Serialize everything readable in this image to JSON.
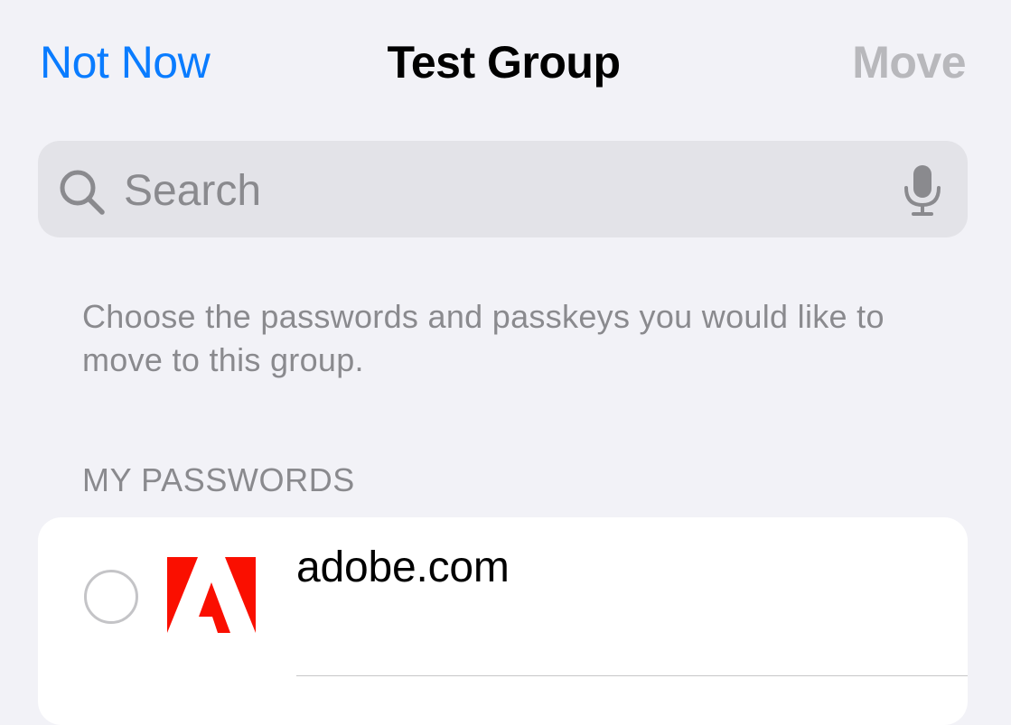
{
  "nav": {
    "left_label": "Not Now",
    "title": "Test Group",
    "right_label": "Move"
  },
  "search": {
    "placeholder": "Search",
    "value": "",
    "left_icon": "magnifying-glass-icon",
    "right_icon": "microphone-icon"
  },
  "description": "Choose the passwords and passkeys you would like to move to this group.",
  "section": {
    "header": "MY PASSWORDS",
    "items": [
      {
        "title": "adobe.com",
        "icon": "adobe-logo",
        "selected": false
      }
    ]
  },
  "colors": {
    "background": "#f2f2f7",
    "accent": "#0a7cff",
    "disabled": "#b8b8bc",
    "secondary_text": "#8a8a8e",
    "search_field": "#e3e3e8",
    "adobe_red": "#fa0f00"
  }
}
